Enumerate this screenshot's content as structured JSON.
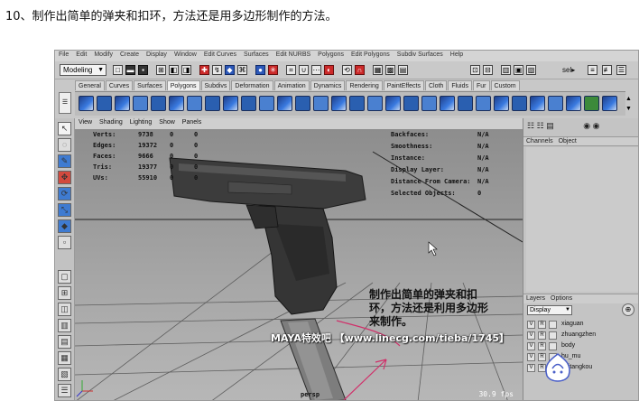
{
  "caption": "10、制作出简单的弹夹和扣环，方法还是用多边形制作的方法。",
  "maya": {
    "menubar": [
      "File",
      "Edit",
      "Modify",
      "Create",
      "Display",
      "Window",
      "Edit Curves",
      "Surfaces",
      "Edit NURBS",
      "Polygons",
      "Edit Polygons",
      "Subdiv Surfaces",
      "Help"
    ],
    "mode_select": "Modeling",
    "status_right": "sel▸",
    "shelf_tabs": [
      "General",
      "Curves",
      "Surfaces",
      "Polygons",
      "Subdivs",
      "Deformation",
      "Animation",
      "Dynamics",
      "Rendering",
      "PaintEffects",
      "Cloth",
      "Fluids",
      "Fur",
      "Custom"
    ],
    "active_shelf_tab": "Polygons",
    "panel_menu": [
      "View",
      "Shading",
      "Lighting",
      "Show",
      "Panels"
    ],
    "hud_left": [
      {
        "label": "Verts:",
        "v1": "9738",
        "v2": "0",
        "v3": "0"
      },
      {
        "label": "Edges:",
        "v1": "19372",
        "v2": "0",
        "v3": "0"
      },
      {
        "label": "Faces:",
        "v1": "9666",
        "v2": "0",
        "v3": "0"
      },
      {
        "label": "Tris:",
        "v1": "19377",
        "v2": "0",
        "v3": "0"
      },
      {
        "label": "UVs:",
        "v1": "55910",
        "v2": "0",
        "v3": "0"
      }
    ],
    "hud_right": [
      {
        "label": "Backfaces:",
        "value": "N/A"
      },
      {
        "label": "Smoothness:",
        "value": "N/A"
      },
      {
        "label": "Instance:",
        "value": "N/A"
      },
      {
        "label": "Display Layer:",
        "value": "N/A"
      },
      {
        "label": "Distance From Camera:",
        "value": "N/A"
      },
      {
        "label": "Selected Objects:",
        "value": "0"
      }
    ],
    "viewport_label": "persp",
    "fps": "30.9 fps",
    "annotation": "制作出简单的弹夹和扣环，方法还是利用多边形来制作。",
    "channels_menu": [
      "Channels",
      "Object"
    ],
    "layers_menu": [
      "Layers",
      "Options"
    ],
    "layers_display": "Display",
    "layers": [
      {
        "v": "V",
        "r": "R",
        "name": "xiaguan"
      },
      {
        "v": "V",
        "r": "R",
        "name": "zhuangzhen"
      },
      {
        "v": "V",
        "r": "R",
        "name": "body"
      },
      {
        "v": "V",
        "r": "R",
        "name": "hu_mu"
      },
      {
        "v": "V",
        "r": "R",
        "name": "huitangkou"
      }
    ]
  },
  "watermark": "MAYA特效吧  【www.linecg.com/tieba/1745】",
  "colors": {
    "viewport_top": "#8d8d8d",
    "viewport_bottom": "#b7b7b7",
    "shelf_icon_blue": "#2a5fb0",
    "annotation_arrow": "#d0306a"
  }
}
